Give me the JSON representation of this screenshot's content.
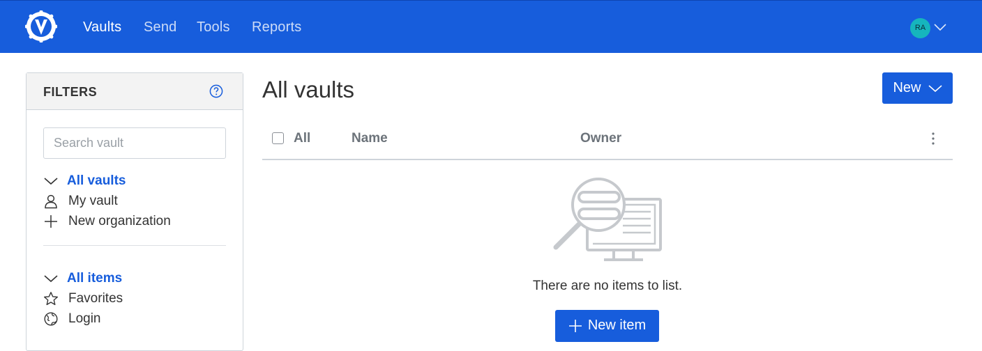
{
  "nav": {
    "items": [
      "Vaults",
      "Send",
      "Tools",
      "Reports"
    ],
    "active": "Vaults",
    "avatar_initials": "RA",
    "brand_color": "#175ddc"
  },
  "filters": {
    "title": "FILTERS",
    "search_placeholder": "Search vault",
    "vaults_heading": "All vaults",
    "vaults": [
      {
        "label": "My vault",
        "icon": "user-icon"
      },
      {
        "label": "New organization",
        "icon": "plus-icon"
      }
    ],
    "items_heading": "All items",
    "items": [
      {
        "label": "Favorites",
        "icon": "star-icon"
      },
      {
        "label": "Login",
        "icon": "globe-icon"
      }
    ]
  },
  "main": {
    "title": "All vaults",
    "new_label": "New",
    "columns": {
      "all": "All",
      "name": "Name",
      "owner": "Owner"
    },
    "empty_text": "There are no items to list.",
    "new_item_label": "New item"
  }
}
